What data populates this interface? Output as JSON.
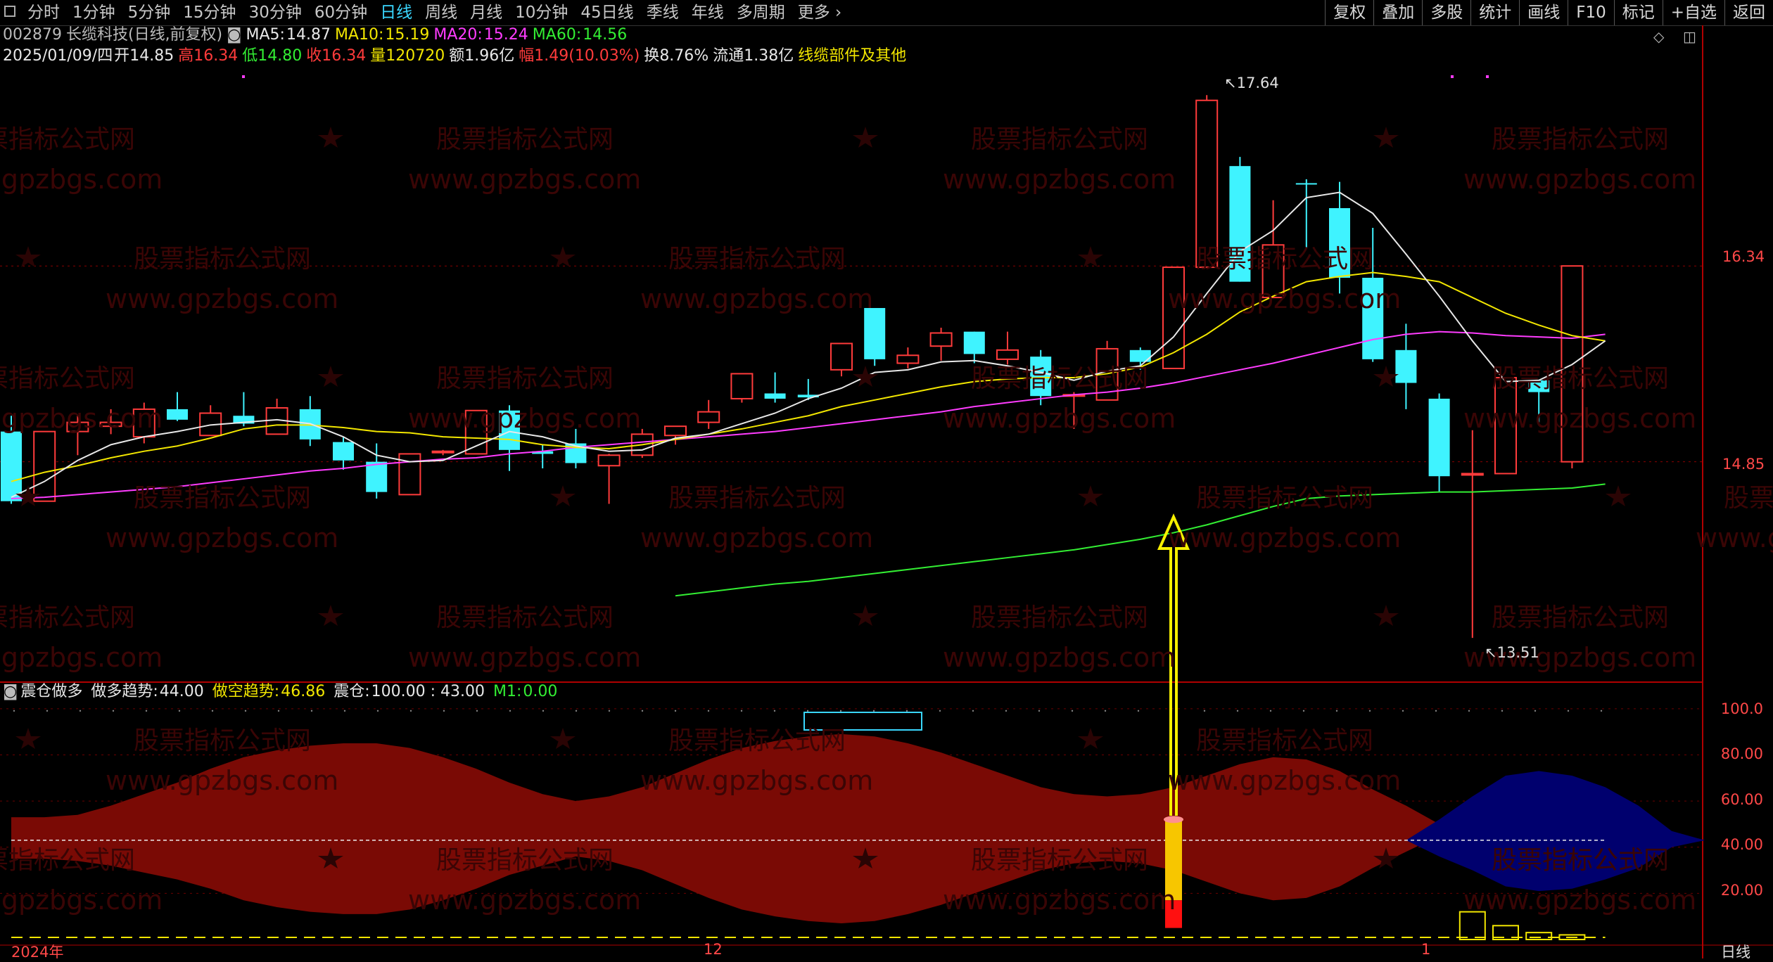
{
  "toolbar": {
    "tabs": [
      "分时",
      "1分钟",
      "5分钟",
      "15分钟",
      "30分钟",
      "60分钟",
      "日线",
      "周线",
      "月线",
      "10分钟",
      "45日线",
      "季线",
      "年线",
      "多周期",
      "更多"
    ],
    "active_tab": "日线",
    "right_tools": [
      "复权",
      "叠加",
      "多股",
      "统计",
      "画线",
      "F10",
      "标记",
      "+自选",
      "返回"
    ]
  },
  "header": {
    "code": "002879",
    "name": "长缆科技(日线,前复权)",
    "ma5_label": "MA5:",
    "ma5_value": "14.87",
    "ma10_label": "MA10:",
    "ma10_value": "15.19",
    "ma20_label": "MA20:",
    "ma20_value": "15.24",
    "ma60_label": "MA60:",
    "ma60_value": "14.56"
  },
  "quote": {
    "date": "2025/01/09/四",
    "open_label": "开",
    "open": "14.85",
    "high_label": "高",
    "high": "16.34",
    "low_label": "低",
    "low": "14.80",
    "close_label": "收",
    "close": "16.34",
    "vol_label": "量",
    "vol": "120720",
    "amount_label": "额",
    "amount": "1.96亿",
    "change_label": "幅",
    "change": "1.49(10.03%)",
    "turnover_label": "换",
    "turnover": "8.76%",
    "float_label": "流通",
    "float": "1.38亿",
    "sector": "线缆部件及其他"
  },
  "price_axis": [
    "16.34",
    "14.85"
  ],
  "annotations": {
    "high_mark": "17.64",
    "low_mark": "13.51"
  },
  "indicator": {
    "name": "震仓做多",
    "long_label": "做多趋势:",
    "long_value": "44.00",
    "short_label": "做空趋势:",
    "short_value": "46.86",
    "shake_label": "震仓:",
    "shake_value": "100.00 : 43.00",
    "m1_label": "M1:",
    "m1_value": "0.00",
    "axis": [
      "100.0",
      "80.00",
      "60.00",
      "40.00",
      "20.00"
    ]
  },
  "time_axis": [
    "2024年",
    "12",
    "1"
  ],
  "period_label": "日线",
  "watermark": {
    "cn": "股票指标公式网",
    "url": "www.gpzbgs.com"
  },
  "colors": {
    "up": "#ff3b3b",
    "down": "#3ff3ff",
    "ma5": "#e8e8e8",
    "ma10": "#f2e600",
    "ma20": "#ff3cff",
    "ma60": "#33ee33",
    "fill_red": "#7a0a05",
    "fill_blue": "#00006e"
  },
  "chart_data": {
    "type": "candlestick",
    "candles": [
      {
        "o": 15.08,
        "h": 15.2,
        "l": 14.53,
        "c": 14.55
      },
      {
        "o": 14.55,
        "h": 15.08,
        "l": 14.55,
        "c": 15.08
      },
      {
        "o": 15.08,
        "h": 15.2,
        "l": 14.9,
        "c": 15.15
      },
      {
        "o": 15.12,
        "h": 15.25,
        "l": 15.06,
        "c": 15.15
      },
      {
        "o": 15.04,
        "h": 15.3,
        "l": 14.99,
        "c": 15.25
      },
      {
        "o": 15.25,
        "h": 15.38,
        "l": 15.16,
        "c": 15.17
      },
      {
        "o": 15.05,
        "h": 15.28,
        "l": 15.05,
        "c": 15.22
      },
      {
        "o": 15.2,
        "h": 15.38,
        "l": 15.12,
        "c": 15.14
      },
      {
        "o": 15.06,
        "h": 15.33,
        "l": 15.06,
        "c": 15.26
      },
      {
        "o": 15.25,
        "h": 15.35,
        "l": 14.97,
        "c": 15.02
      },
      {
        "o": 15.0,
        "h": 15.04,
        "l": 14.79,
        "c": 14.86
      },
      {
        "o": 14.85,
        "h": 14.99,
        "l": 14.57,
        "c": 14.62
      },
      {
        "o": 14.6,
        "h": 14.91,
        "l": 14.6,
        "c": 14.91
      },
      {
        "o": 14.92,
        "h": 14.94,
        "l": 14.9,
        "c": 14.93
      },
      {
        "o": 14.91,
        "h": 15.24,
        "l": 14.91,
        "c": 15.24
      },
      {
        "o": 15.24,
        "h": 15.28,
        "l": 14.78,
        "c": 14.94
      },
      {
        "o": 14.93,
        "h": 14.98,
        "l": 14.8,
        "c": 14.91
      },
      {
        "o": 14.99,
        "h": 15.1,
        "l": 14.8,
        "c": 14.84
      },
      {
        "o": 14.82,
        "h": 14.91,
        "l": 14.53,
        "c": 14.9
      },
      {
        "o": 14.9,
        "h": 15.1,
        "l": 14.88,
        "c": 15.06
      },
      {
        "o": 15.05,
        "h": 15.12,
        "l": 14.98,
        "c": 15.12
      },
      {
        "o": 15.15,
        "h": 15.32,
        "l": 15.1,
        "c": 15.23
      },
      {
        "o": 15.33,
        "h": 15.52,
        "l": 15.3,
        "c": 15.52
      },
      {
        "o": 15.37,
        "h": 15.53,
        "l": 15.3,
        "c": 15.33
      },
      {
        "o": 15.36,
        "h": 15.48,
        "l": 15.32,
        "c": 15.34
      },
      {
        "o": 15.55,
        "h": 15.74,
        "l": 15.5,
        "c": 15.75
      },
      {
        "o": 16.02,
        "h": 16.02,
        "l": 15.58,
        "c": 15.63
      },
      {
        "o": 15.6,
        "h": 15.72,
        "l": 15.56,
        "c": 15.66
      },
      {
        "o": 15.73,
        "h": 15.87,
        "l": 15.62,
        "c": 15.83
      },
      {
        "o": 15.84,
        "h": 15.84,
        "l": 15.6,
        "c": 15.67
      },
      {
        "o": 15.63,
        "h": 15.84,
        "l": 15.59,
        "c": 15.7
      },
      {
        "o": 15.65,
        "h": 15.7,
        "l": 15.28,
        "c": 15.35
      },
      {
        "o": 15.36,
        "h": 15.38,
        "l": 15.1,
        "c": 15.36
      },
      {
        "o": 15.32,
        "h": 15.77,
        "l": 15.32,
        "c": 15.71
      },
      {
        "o": 15.7,
        "h": 15.72,
        "l": 15.55,
        "c": 15.61
      },
      {
        "o": 15.56,
        "h": 16.33,
        "l": 15.56,
        "c": 16.33
      },
      {
        "o": 16.33,
        "h": 17.64,
        "l": 16.33,
        "c": 17.6
      },
      {
        "o": 17.1,
        "h": 17.17,
        "l": 16.22,
        "c": 16.22
      },
      {
        "o": 16.1,
        "h": 16.84,
        "l": 16.1,
        "c": 16.5
      },
      {
        "o": 16.97,
        "h": 17.0,
        "l": 16.47,
        "c": 16.96
      },
      {
        "o": 16.78,
        "h": 16.98,
        "l": 16.13,
        "c": 16.25
      },
      {
        "o": 16.25,
        "h": 16.63,
        "l": 15.61,
        "c": 15.63
      },
      {
        "o": 15.7,
        "h": 15.9,
        "l": 15.25,
        "c": 15.45
      },
      {
        "o": 15.33,
        "h": 15.37,
        "l": 14.62,
        "c": 14.74
      },
      {
        "o": 14.76,
        "h": 15.09,
        "l": 13.51,
        "c": 14.76
      },
      {
        "o": 14.76,
        "h": 15.49,
        "l": 14.76,
        "c": 15.49
      },
      {
        "o": 15.47,
        "h": 15.47,
        "l": 15.15,
        "c": 15.38
      },
      {
        "o": 14.85,
        "h": 16.34,
        "l": 14.8,
        "c": 16.34
      }
    ],
    "ma5": [
      14.58,
      14.7,
      14.86,
      14.98,
      15.04,
      15.08,
      15.13,
      15.15,
      15.17,
      15.14,
      15.04,
      14.9,
      14.85,
      14.86,
      14.97,
      15.08,
      15.04,
      14.97,
      14.93,
      14.94,
      15.03,
      15.06,
      15.14,
      15.22,
      15.33,
      15.41,
      15.53,
      15.55,
      15.61,
      15.62,
      15.58,
      15.53,
      15.47,
      15.54,
      15.58,
      15.8,
      16.13,
      16.45,
      16.61,
      16.86,
      16.9,
      16.74,
      16.43,
      16.11,
      15.77,
      15.46,
      15.47,
      15.59,
      15.77
    ],
    "ma10": [
      14.7,
      14.77,
      14.82,
      14.88,
      14.93,
      14.97,
      15.03,
      15.1,
      15.13,
      15.13,
      15.11,
      15.08,
      15.07,
      15.04,
      15.03,
      15.02,
      14.98,
      14.96,
      14.95,
      14.98,
      15.02,
      15.06,
      15.1,
      15.15,
      15.2,
      15.27,
      15.32,
      15.37,
      15.42,
      15.46,
      15.48,
      15.49,
      15.49,
      15.52,
      15.57,
      15.68,
      15.82,
      15.99,
      16.11,
      16.22,
      16.26,
      16.29,
      16.26,
      16.22,
      16.1,
      15.98,
      15.89,
      15.81,
      15.77
    ],
    "ma20": [
      14.57,
      14.58,
      14.6,
      14.62,
      14.64,
      14.66,
      14.69,
      14.72,
      14.75,
      14.78,
      14.8,
      14.83,
      14.85,
      14.87,
      14.88,
      14.91,
      14.93,
      14.96,
      14.98,
      15.0,
      15.02,
      15.04,
      15.06,
      15.08,
      15.11,
      15.14,
      15.17,
      15.2,
      15.23,
      15.27,
      15.3,
      15.33,
      15.36,
      15.38,
      15.41,
      15.45,
      15.5,
      15.55,
      15.6,
      15.66,
      15.72,
      15.78,
      15.82,
      15.84,
      15.83,
      15.81,
      15.8,
      15.79,
      15.82
    ],
    "ma60": {
      "start": 20,
      "values": [
        13.83,
        13.86,
        13.89,
        13.92,
        13.94,
        13.97,
        14.0,
        14.03,
        14.06,
        14.09,
        14.12,
        14.15,
        14.18,
        14.22,
        14.26,
        14.31,
        14.37,
        14.44,
        14.51,
        14.57,
        14.59,
        14.6,
        14.61,
        14.62,
        14.62,
        14.63,
        14.64,
        14.65,
        14.68
      ]
    },
    "ylim": [
      13.2,
      17.85
    ],
    "indicator_band_red": {
      "upper": [
        53,
        53,
        54,
        58,
        63,
        68,
        74,
        79,
        82,
        84,
        85,
        85,
        83,
        79,
        74,
        68,
        63,
        60,
        62,
        66,
        72,
        78,
        83,
        86,
        88,
        89,
        88,
        85,
        81,
        76,
        71,
        66,
        63,
        62,
        63,
        66,
        71,
        76,
        79,
        78,
        73,
        65,
        58,
        50,
        46,
        44,
        43,
        43,
        43
      ],
      "lower": [
        35,
        35,
        34,
        32,
        29,
        26,
        22,
        17,
        14,
        12,
        11,
        11,
        13,
        17,
        22,
        28,
        32,
        36,
        34,
        30,
        24,
        18,
        13,
        10,
        8,
        7,
        8,
        11,
        15,
        20,
        25,
        30,
        33,
        34,
        33,
        30,
        25,
        20,
        17,
        18,
        23,
        31,
        38,
        45,
        48,
        48,
        48,
        48,
        48
      ]
    },
    "indicator_band_blue": {
      "from": 42,
      "upper": [
        43,
        52,
        62,
        71,
        73,
        71,
        66,
        58,
        47,
        43
      ],
      "lower": [
        43,
        36,
        30,
        23,
        21,
        22,
        26,
        31,
        40,
        43
      ]
    },
    "volume_bars": {
      "from": 44,
      "values": [
        12,
        6,
        3,
        2
      ]
    },
    "signal_bar": {
      "index": 35,
      "yellow": [
        17,
        52
      ],
      "red": [
        5,
        17
      ]
    },
    "indicator_ylim": [
      0,
      110
    ]
  }
}
